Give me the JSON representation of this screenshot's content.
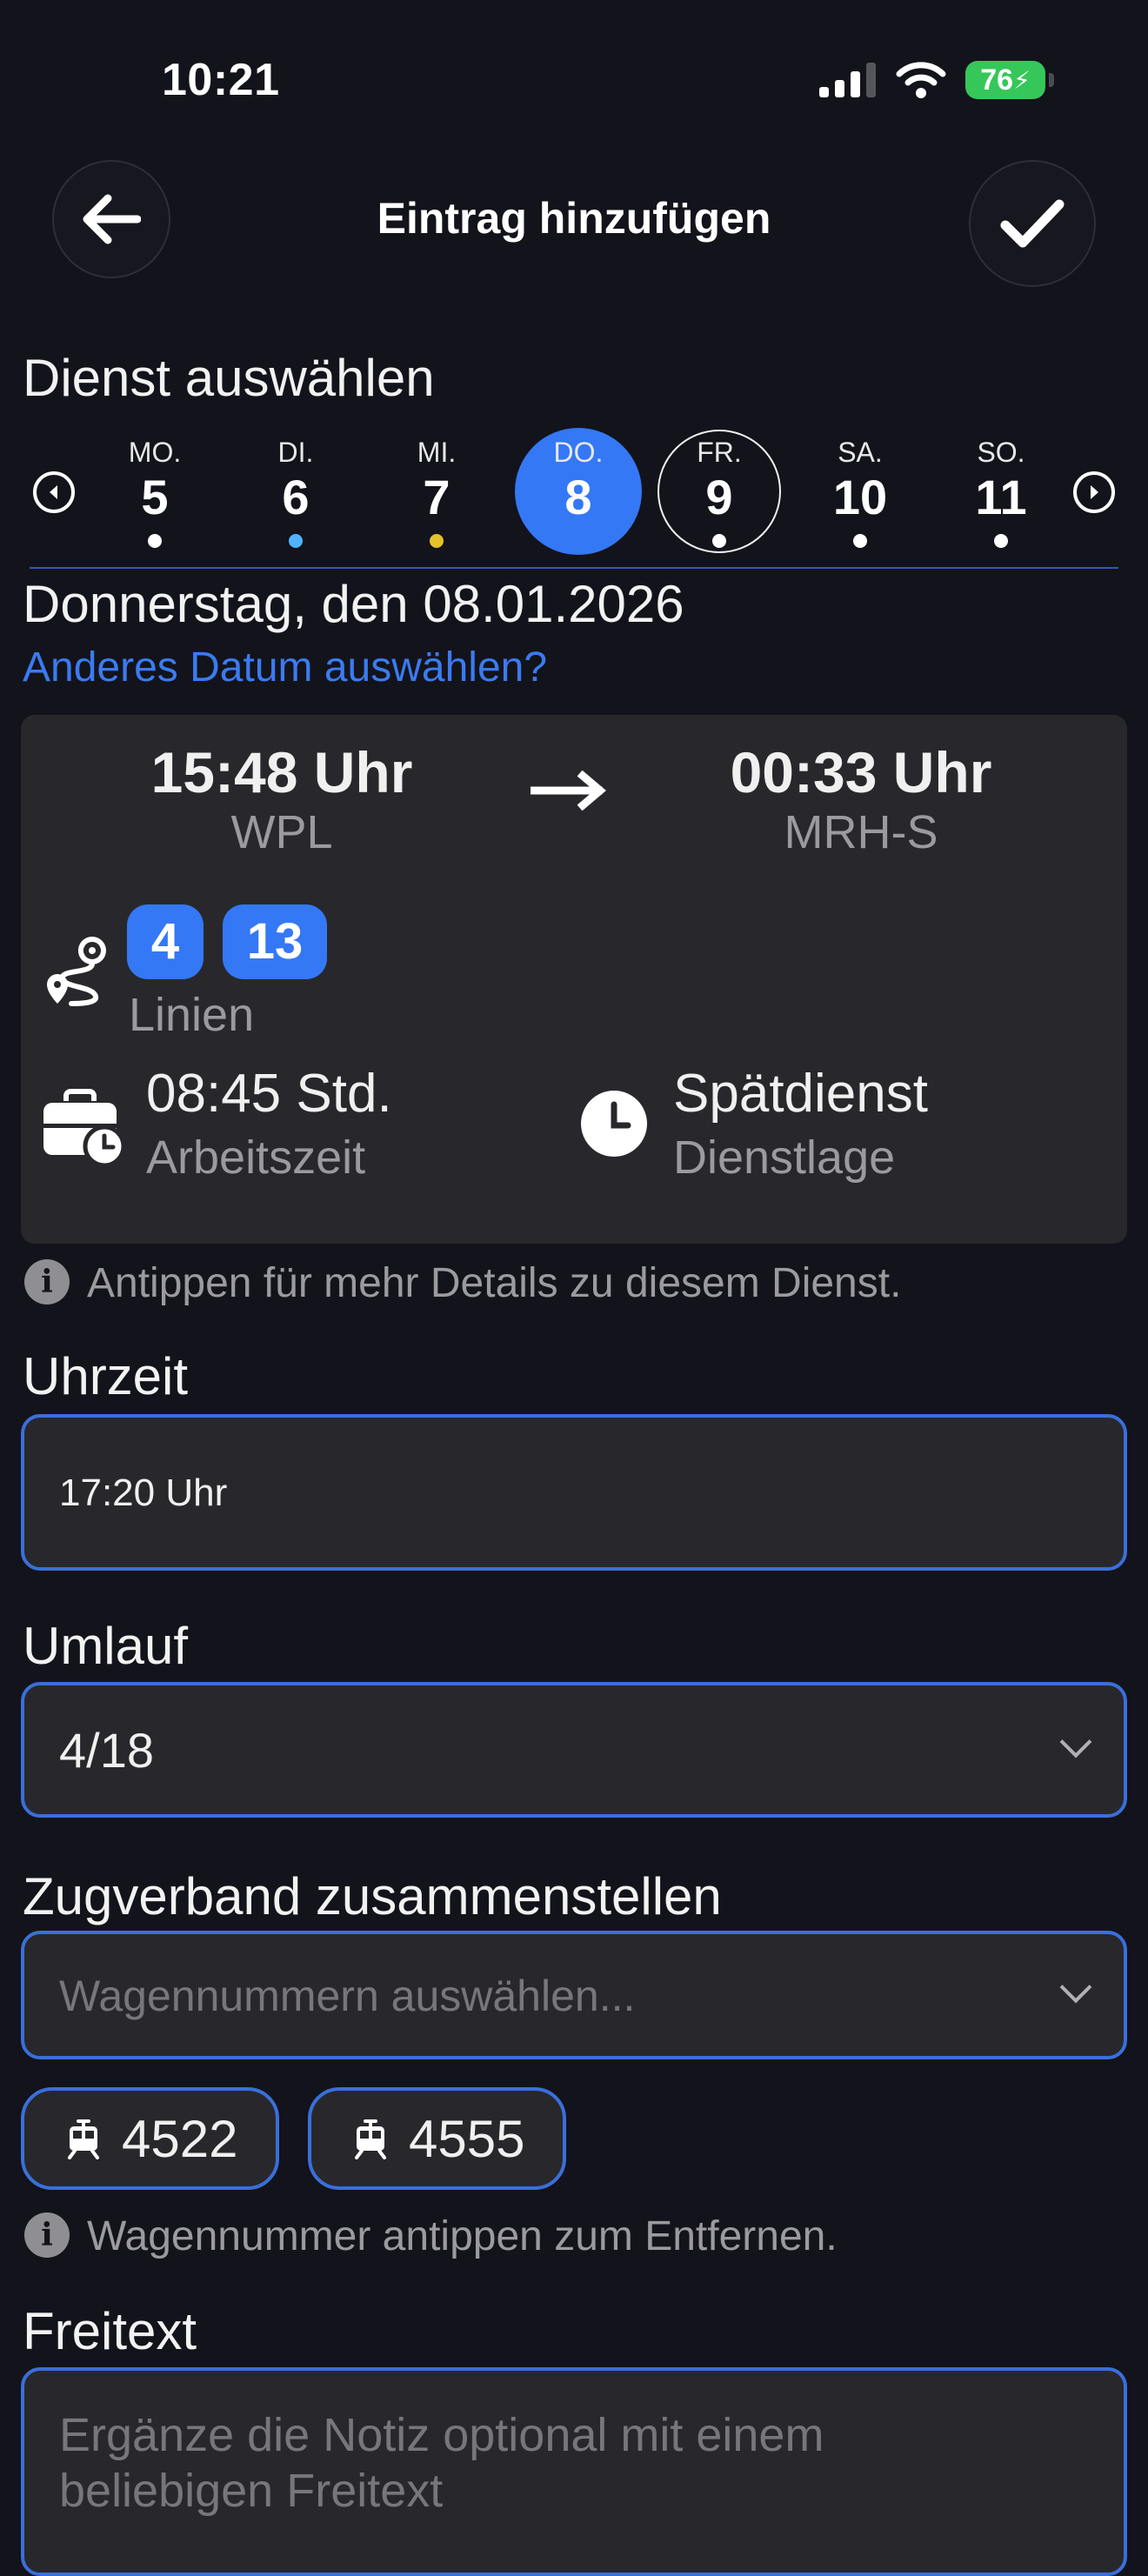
{
  "status_bar": {
    "time": "10:21",
    "battery": "76"
  },
  "header": {
    "title": "Eintrag hinzufügen",
    "back_icon": "arrow-left-icon",
    "confirm_icon": "checkmark-icon"
  },
  "dienst": {
    "heading": "Dienst auswählen",
    "days": [
      {
        "weekday": "MO.",
        "day": "5",
        "dot": "#ffffff"
      },
      {
        "weekday": "DI.",
        "day": "6",
        "dot": "#4fb3ff"
      },
      {
        "weekday": "MI.",
        "day": "7",
        "dot": "#e3c229"
      },
      {
        "weekday": "DO.",
        "day": "8",
        "dot": "",
        "selected": true
      },
      {
        "weekday": "FR.",
        "day": "9",
        "dot": "#ffffff",
        "today": true
      },
      {
        "weekday": "SA.",
        "day": "10",
        "dot": "#ffffff"
      },
      {
        "weekday": "SO.",
        "day": "11",
        "dot": "#ffffff"
      }
    ],
    "date_text": "Donnerstag, den 08.01.2026",
    "other_date_link": "Anderes Datum auswählen?"
  },
  "card": {
    "start_time": "15:48 Uhr",
    "start_place": "WPL",
    "end_time": "00:33 Uhr",
    "end_place": "MRH-S",
    "lines": [
      "4",
      "13"
    ],
    "lines_label": "Linien",
    "work_time": "08:45 Std.",
    "work_time_label": "Arbeitszeit",
    "shift": "Spätdienst",
    "shift_label": "Dienstlage"
  },
  "hint_details": "Antippen für mehr Details zu diesem Dienst.",
  "uhrzeit": {
    "label": "Uhrzeit",
    "value": "17:20 Uhr"
  },
  "umlauf": {
    "label": "Umlauf",
    "value": "4/18"
  },
  "zugverband": {
    "label": "Zugverband zusammenstellen",
    "placeholder": "Wagennummern auswählen...",
    "wagons": [
      "4522",
      "4555"
    ],
    "hint": "Wagennummer antippen zum Entfernen."
  },
  "freitext": {
    "label": "Freitext",
    "placeholder": "Ergänze die Notiz optional mit einem beliebigen Freitext"
  },
  "colors": {
    "background": "#13131b",
    "accent": "#3478f6",
    "card": "#28282c"
  }
}
